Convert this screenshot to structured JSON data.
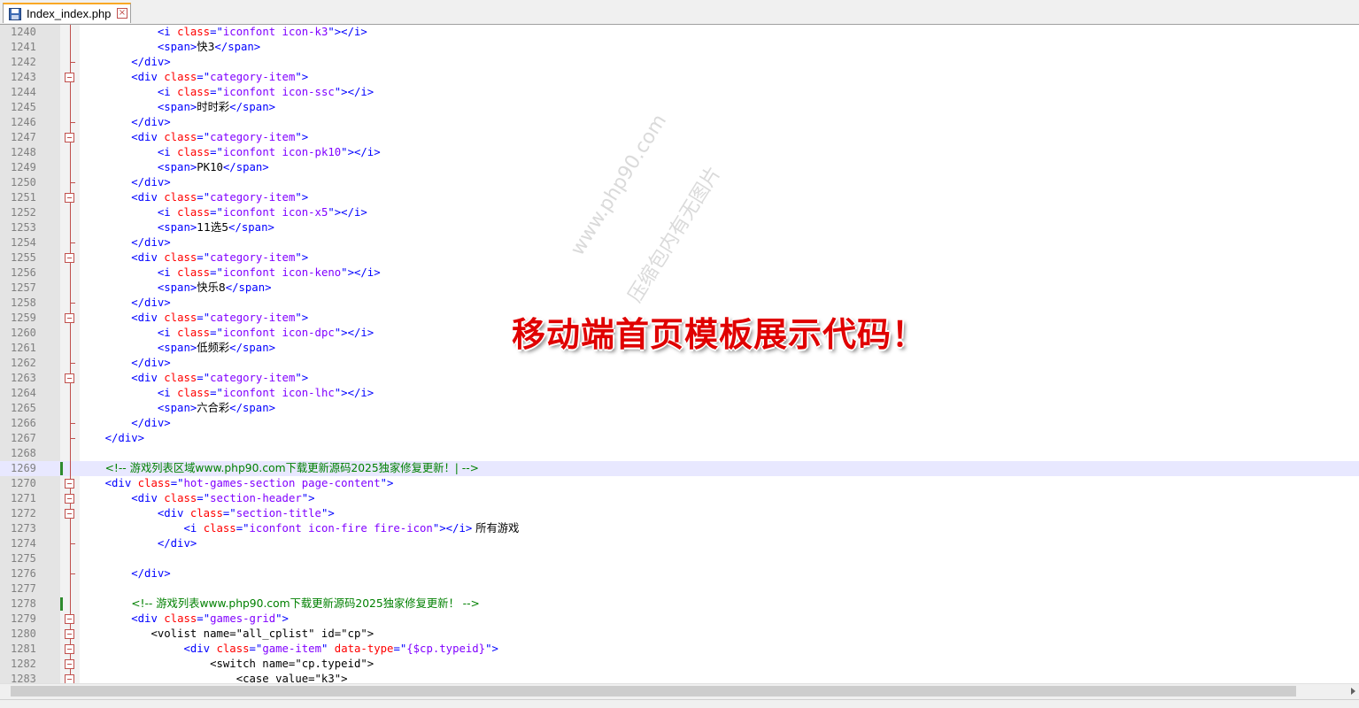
{
  "tab": {
    "label": "Index_index.php",
    "close_glyph": "×",
    "icon": "save-file-icon"
  },
  "lines": [
    {
      "n": "1240",
      "pre": "            ",
      "parts": [
        [
          "t",
          "<i "
        ],
        [
          "a",
          "class"
        ],
        [
          "t",
          "=\""
        ],
        [
          "v",
          "iconfont icon-k3"
        ],
        [
          "t",
          "\"></i>"
        ]
      ]
    },
    {
      "n": "1241",
      "pre": "            ",
      "parts": [
        [
          "t",
          "<span>"
        ],
        [
          "x",
          "快3"
        ],
        [
          "t",
          "</span>"
        ]
      ]
    },
    {
      "n": "1242",
      "pre": "        ",
      "parts": [
        [
          "t",
          "</div>"
        ]
      ]
    },
    {
      "n": "1243",
      "pre": "        ",
      "parts": [
        [
          "t",
          "<div "
        ],
        [
          "a",
          "class"
        ],
        [
          "t",
          "=\""
        ],
        [
          "v",
          "category-item"
        ],
        [
          "t",
          "\">"
        ]
      ]
    },
    {
      "n": "1244",
      "pre": "            ",
      "parts": [
        [
          "t",
          "<i "
        ],
        [
          "a",
          "class"
        ],
        [
          "t",
          "=\""
        ],
        [
          "v",
          "iconfont icon-ssc"
        ],
        [
          "t",
          "\"></i>"
        ]
      ]
    },
    {
      "n": "1245",
      "pre": "            ",
      "parts": [
        [
          "t",
          "<span>"
        ],
        [
          "x",
          "时时彩"
        ],
        [
          "t",
          "</span>"
        ]
      ]
    },
    {
      "n": "1246",
      "pre": "        ",
      "parts": [
        [
          "t",
          "</div>"
        ]
      ]
    },
    {
      "n": "1247",
      "pre": "        ",
      "parts": [
        [
          "t",
          "<div "
        ],
        [
          "a",
          "class"
        ],
        [
          "t",
          "=\""
        ],
        [
          "v",
          "category-item"
        ],
        [
          "t",
          "\">"
        ]
      ]
    },
    {
      "n": "1248",
      "pre": "            ",
      "parts": [
        [
          "t",
          "<i "
        ],
        [
          "a",
          "class"
        ],
        [
          "t",
          "=\""
        ],
        [
          "v",
          "iconfont icon-pk10"
        ],
        [
          "t",
          "\"></i>"
        ]
      ]
    },
    {
      "n": "1249",
      "pre": "            ",
      "parts": [
        [
          "t",
          "<span>"
        ],
        [
          "x",
          "PK10"
        ],
        [
          "t",
          "</span>"
        ]
      ]
    },
    {
      "n": "1250",
      "pre": "        ",
      "parts": [
        [
          "t",
          "</div>"
        ]
      ]
    },
    {
      "n": "1251",
      "pre": "        ",
      "parts": [
        [
          "t",
          "<div "
        ],
        [
          "a",
          "class"
        ],
        [
          "t",
          "=\""
        ],
        [
          "v",
          "category-item"
        ],
        [
          "t",
          "\">"
        ]
      ]
    },
    {
      "n": "1252",
      "pre": "            ",
      "parts": [
        [
          "t",
          "<i "
        ],
        [
          "a",
          "class"
        ],
        [
          "t",
          "=\""
        ],
        [
          "v",
          "iconfont icon-x5"
        ],
        [
          "t",
          "\"></i>"
        ]
      ]
    },
    {
      "n": "1253",
      "pre": "            ",
      "parts": [
        [
          "t",
          "<span>"
        ],
        [
          "x",
          "11选5"
        ],
        [
          "t",
          "</span>"
        ]
      ]
    },
    {
      "n": "1254",
      "pre": "        ",
      "parts": [
        [
          "t",
          "</div>"
        ]
      ]
    },
    {
      "n": "1255",
      "pre": "        ",
      "parts": [
        [
          "t",
          "<div "
        ],
        [
          "a",
          "class"
        ],
        [
          "t",
          "=\""
        ],
        [
          "v",
          "category-item"
        ],
        [
          "t",
          "\">"
        ]
      ]
    },
    {
      "n": "1256",
      "pre": "            ",
      "parts": [
        [
          "t",
          "<i "
        ],
        [
          "a",
          "class"
        ],
        [
          "t",
          "=\""
        ],
        [
          "v",
          "iconfont icon-keno"
        ],
        [
          "t",
          "\"></i>"
        ]
      ]
    },
    {
      "n": "1257",
      "pre": "            ",
      "parts": [
        [
          "t",
          "<span>"
        ],
        [
          "x",
          "快乐8"
        ],
        [
          "t",
          "</span>"
        ]
      ]
    },
    {
      "n": "1258",
      "pre": "        ",
      "parts": [
        [
          "t",
          "</div>"
        ]
      ]
    },
    {
      "n": "1259",
      "pre": "        ",
      "parts": [
        [
          "t",
          "<div "
        ],
        [
          "a",
          "class"
        ],
        [
          "t",
          "=\""
        ],
        [
          "v",
          "category-item"
        ],
        [
          "t",
          "\">"
        ]
      ]
    },
    {
      "n": "1260",
      "pre": "            ",
      "parts": [
        [
          "t",
          "<i "
        ],
        [
          "a",
          "class"
        ],
        [
          "t",
          "=\""
        ],
        [
          "v",
          "iconfont icon-dpc"
        ],
        [
          "t",
          "\"></i>"
        ]
      ]
    },
    {
      "n": "1261",
      "pre": "            ",
      "parts": [
        [
          "t",
          "<span>"
        ],
        [
          "x",
          "低频彩"
        ],
        [
          "t",
          "</span>"
        ]
      ]
    },
    {
      "n": "1262",
      "pre": "        ",
      "parts": [
        [
          "t",
          "</div>"
        ]
      ]
    },
    {
      "n": "1263",
      "pre": "        ",
      "parts": [
        [
          "t",
          "<div "
        ],
        [
          "a",
          "class"
        ],
        [
          "t",
          "=\""
        ],
        [
          "v",
          "category-item"
        ],
        [
          "t",
          "\">"
        ]
      ]
    },
    {
      "n": "1264",
      "pre": "            ",
      "parts": [
        [
          "t",
          "<i "
        ],
        [
          "a",
          "class"
        ],
        [
          "t",
          "=\""
        ],
        [
          "v",
          "iconfont icon-lhc"
        ],
        [
          "t",
          "\"></i>"
        ]
      ]
    },
    {
      "n": "1265",
      "pre": "            ",
      "parts": [
        [
          "t",
          "<span>"
        ],
        [
          "x",
          "六合彩"
        ],
        [
          "t",
          "</span>"
        ]
      ]
    },
    {
      "n": "1266",
      "pre": "        ",
      "parts": [
        [
          "t",
          "</div>"
        ]
      ]
    },
    {
      "n": "1267",
      "pre": "    ",
      "parts": [
        [
          "t",
          "</div>"
        ]
      ]
    },
    {
      "n": "1268",
      "pre": "",
      "parts": []
    },
    {
      "n": "1269",
      "pre": "    ",
      "parts": [
        [
          "c",
          "<!-- 游戏列表区域www.php90.com下载更新源码2025独家修复更新！| -->"
        ]
      ]
    },
    {
      "n": "1270",
      "pre": "    ",
      "parts": [
        [
          "t",
          "<div "
        ],
        [
          "a",
          "class"
        ],
        [
          "t",
          "=\""
        ],
        [
          "v",
          "hot-games-section page-content"
        ],
        [
          "t",
          "\">"
        ]
      ]
    },
    {
      "n": "1271",
      "pre": "        ",
      "parts": [
        [
          "t",
          "<div "
        ],
        [
          "a",
          "class"
        ],
        [
          "t",
          "=\""
        ],
        [
          "v",
          "section-header"
        ],
        [
          "t",
          "\">"
        ]
      ]
    },
    {
      "n": "1272",
      "pre": "            ",
      "parts": [
        [
          "t",
          "<div "
        ],
        [
          "a",
          "class"
        ],
        [
          "t",
          "=\""
        ],
        [
          "v",
          "section-title"
        ],
        [
          "t",
          "\">"
        ]
      ]
    },
    {
      "n": "1273",
      "pre": "                ",
      "parts": [
        [
          "t",
          "<i "
        ],
        [
          "a",
          "class"
        ],
        [
          "t",
          "=\""
        ],
        [
          "v",
          "iconfont icon-fire fire-icon"
        ],
        [
          "t",
          "\"></i>"
        ],
        [
          "x",
          " 所有游戏"
        ]
      ]
    },
    {
      "n": "1274",
      "pre": "            ",
      "parts": [
        [
          "t",
          "</div>"
        ]
      ]
    },
    {
      "n": "1275",
      "pre": "",
      "parts": []
    },
    {
      "n": "1276",
      "pre": "        ",
      "parts": [
        [
          "t",
          "</div>"
        ]
      ]
    },
    {
      "n": "1277",
      "pre": "",
      "parts": []
    },
    {
      "n": "1278",
      "pre": "        ",
      "parts": [
        [
          "c",
          "<!-- 游戏列表www.php90.com下载更新源码2025独家修复更新！ -->"
        ]
      ]
    },
    {
      "n": "1279",
      "pre": "        ",
      "parts": [
        [
          "t",
          "<div "
        ],
        [
          "a",
          "class"
        ],
        [
          "t",
          "=\""
        ],
        [
          "v",
          "games-grid"
        ],
        [
          "t",
          "\">"
        ]
      ]
    },
    {
      "n": "1280",
      "pre": "           ",
      "parts": [
        [
          "x",
          "<volist name=\"all_cplist\" id=\"cp\">"
        ]
      ]
    },
    {
      "n": "1281",
      "pre": "                ",
      "parts": [
        [
          "t",
          "<div "
        ],
        [
          "a",
          "class"
        ],
        [
          "t",
          "=\""
        ],
        [
          "v",
          "game-item"
        ],
        [
          "t",
          "\" "
        ],
        [
          "a",
          "data-type"
        ],
        [
          "t",
          "=\""
        ],
        [
          "v",
          "{$cp.typeid}"
        ],
        [
          "t",
          "\">"
        ]
      ]
    },
    {
      "n": "1282",
      "pre": "                    ",
      "parts": [
        [
          "x",
          "<switch name=\"cp.typeid\">"
        ]
      ]
    },
    {
      "n": "1283",
      "pre": "                        ",
      "parts": [
        [
          "x",
          "<case value=\"k3\">"
        ]
      ]
    }
  ],
  "overlay": {
    "title": "移动端首页模板展示代码！",
    "watermark_line1": "www.php90.com",
    "watermark_line2": "压缩包内有无图片"
  }
}
